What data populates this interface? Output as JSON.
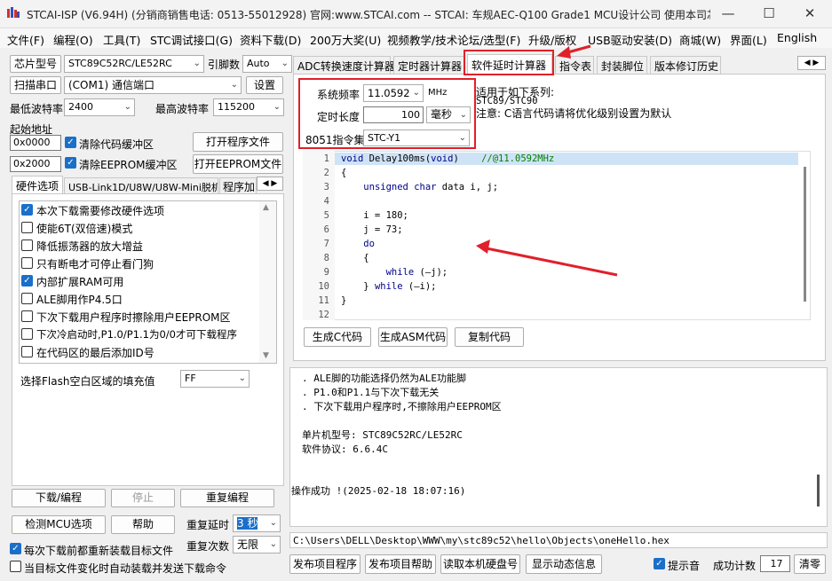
{
  "window": {
    "title": "STCAI-ISP (V6.94H) (分销商销售电话: 0513-55012928) 官网:www.STCAI.com  -- STCAI: 车规AEC-Q100 Grade1 MCU设计公司 使用本司芯片或采…",
    "min_icon": "minimize-icon",
    "max_icon": "maximize-icon",
    "close_icon": "close-icon"
  },
  "menu": [
    "文件(F)",
    "编程(O)",
    "工具(T)",
    "STC调试接口(G)",
    "资料下载(D)",
    "200万大奖(U)",
    "视频教学/技术论坛/选型(F)",
    "升级/版权",
    "USB驱动安装(D)",
    "商城(W)",
    "界面(L)",
    "English"
  ],
  "left": {
    "chip_label": "芯片型号",
    "chip_value": "STC89C52RC/LE52RC",
    "pin_label": "引脚数",
    "pin_value": "Auto",
    "scan_button": "扫描串口",
    "port_value": "(COM1) 通信端口",
    "settings_button": "设置",
    "min_baud_label": "最低波特率",
    "min_baud_value": "2400",
    "max_baud_label": "最高波特率",
    "max_baud_value": "115200",
    "start_addr_label": "起始地址",
    "addr1": "0x0000",
    "clear_code_label": "清除代码缓冲区",
    "open_prog_button": "打开程序文件",
    "addr2": "0x2000",
    "clear_eeprom_label": "清除EEPROM缓冲区",
    "open_eeprom_button": "打开EEPROM文件",
    "hw_tabs": [
      "硬件选项",
      "USB-Link1D/U8W/U8W-Mini脱机",
      "程序加"
    ],
    "hw_options": [
      {
        "label": "本次下载需要修改硬件选项",
        "checked": true
      },
      {
        "label": "使能6T(双倍速)模式",
        "checked": false
      },
      {
        "label": "降低振荡器的放大增益",
        "checked": false
      },
      {
        "label": "只有断电才可停止看门狗",
        "checked": false
      },
      {
        "label": "内部扩展RAM可用",
        "checked": true
      },
      {
        "label": "ALE脚用作P4.5口",
        "checked": false
      },
      {
        "label": "下次下载用户程序时擦除用户EEPROM区",
        "checked": false
      },
      {
        "label": "下次冷启动时,P1.0/P1.1为0/0才可下载程序",
        "checked": false
      },
      {
        "label": "在代码区的最后添加ID号",
        "checked": false
      }
    ],
    "fill_label": "选择Flash空白区域的填充值",
    "fill_value": "FF",
    "download_button": "下载/编程",
    "stop_button": "停止",
    "reprogram_button": "重复编程",
    "check_mcu_button": "检测MCU选项",
    "help_button": "帮助",
    "repeat_delay_label": "重复延时",
    "repeat_delay_value": "3 秒",
    "repeat_count_label": "重复次数",
    "repeat_count_value": "无限",
    "reload_label": "每次下载前都重新装载目标文件",
    "reload_checked": true,
    "auto_send_label": "当目标文件变化时自动装载并发送下载命令",
    "auto_send_checked": false
  },
  "tabs": [
    "ADC转换速度计算器",
    "定时器计算器",
    "软件延时计算器",
    "指令表",
    "封装脚位",
    "版本修订历史"
  ],
  "active_tab": 2,
  "calc": {
    "freq_label": "系统频率",
    "freq_value": "11.0592",
    "freq_unit": "MHz",
    "time_label": "定时长度",
    "time_value": "100",
    "time_unit": "毫秒",
    "isa_label": "8051指令集",
    "isa_value": "STC-Y1",
    "note_line1": "适用于如下系列:",
    "note_line2": "STC89/STC90",
    "note_line3": "注意: C语言代码请将优化级别设置为默认"
  },
  "code_lines": [
    {
      "n": "1",
      "parts": [
        {
          "t": "void",
          "c": "kw"
        },
        {
          "t": " Delay100ms(",
          "c": ""
        },
        {
          "t": "void",
          "c": "kw"
        },
        {
          "t": ")    ",
          "c": ""
        },
        {
          "t": "//@11.0592MHz",
          "c": "cm"
        }
      ]
    },
    {
      "n": "2",
      "parts": [
        {
          "t": "{",
          "c": ""
        }
      ]
    },
    {
      "n": "3",
      "parts": [
        {
          "t": "    ",
          "c": ""
        },
        {
          "t": "unsigned char",
          "c": "kw"
        },
        {
          "t": " data i, j;",
          "c": ""
        }
      ]
    },
    {
      "n": "4",
      "parts": []
    },
    {
      "n": "5",
      "parts": [
        {
          "t": "    i = 180;",
          "c": ""
        }
      ]
    },
    {
      "n": "6",
      "parts": [
        {
          "t": "    j = 73;",
          "c": ""
        }
      ]
    },
    {
      "n": "7",
      "parts": [
        {
          "t": "    ",
          "c": ""
        },
        {
          "t": "do",
          "c": "kw"
        }
      ]
    },
    {
      "n": "8",
      "parts": [
        {
          "t": "    {",
          "c": ""
        }
      ]
    },
    {
      "n": "9",
      "parts": [
        {
          "t": "        ",
          "c": ""
        },
        {
          "t": "while",
          "c": "kw"
        },
        {
          "t": " (—j);",
          "c": ""
        }
      ]
    },
    {
      "n": "10",
      "parts": [
        {
          "t": "    } ",
          "c": ""
        },
        {
          "t": "while",
          "c": "kw"
        },
        {
          "t": " (—i);",
          "c": ""
        }
      ]
    },
    {
      "n": "11",
      "parts": [
        {
          "t": "}",
          "c": ""
        }
      ]
    },
    {
      "n": "12",
      "parts": []
    }
  ],
  "gen_c_button": "生成C代码",
  "gen_asm_button": "生成ASM代码",
  "copy_button": "复制代码",
  "log_lines": [
    ". ALE脚的功能选择仍然为ALE功能脚",
    ". P1.0和P1.1与下次下载无关",
    ". 下次下载用户程序时,不擦除用户EEPROM区",
    "",
    "单片机型号: STC89C52RC/LE52RC",
    "软件协议: 6.6.4C",
    "",
    "",
    "操作成功 !(2025-02-18 18:07:16)"
  ],
  "file_path": "C:\\Users\\DELL\\Desktop\\WWW\\my\\stc89c52\\hello\\Objects\\oneHello.hex",
  "bottom": {
    "publish_prog": "发布项目程序",
    "publish_help": "发布项目帮助",
    "read_disk": "读取本机硬盘号",
    "show_dynamic": "显示动态信息",
    "beep_label": "提示音",
    "beep_checked": true,
    "success_label": "成功计数",
    "success_count": "17",
    "clear_button": "清零"
  },
  "accent": "#e0202a"
}
